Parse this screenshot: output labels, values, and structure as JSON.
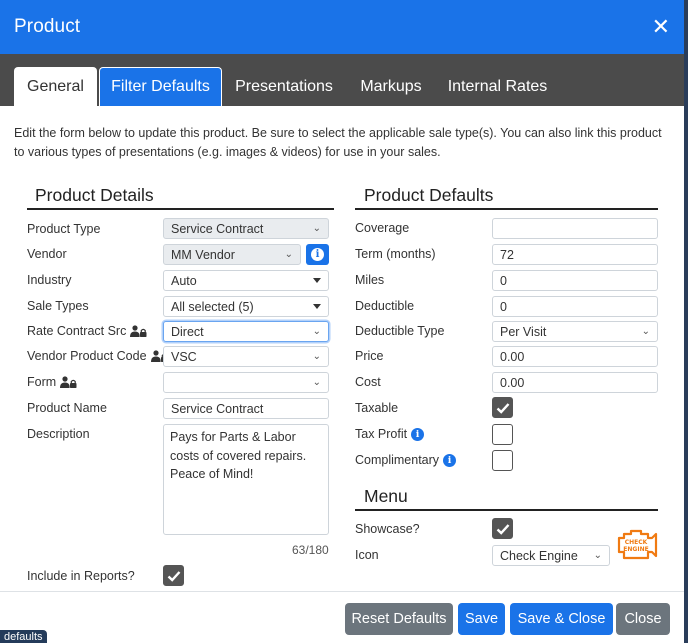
{
  "modal": {
    "title": "Product"
  },
  "tabs": [
    "General",
    "Filter Defaults",
    "Presentations",
    "Markups",
    "Internal Rates"
  ],
  "intro": "Edit the form below to update this product. Be sure to select the applicable sale type(s). You can also link this product to various types of presentations (e.g. images & videos) for use in your sales.",
  "product_details": {
    "title": "Product Details",
    "product_type": {
      "label": "Product Type",
      "value": "Service Contract"
    },
    "vendor": {
      "label": "Vendor",
      "value": "MM Vendor"
    },
    "industry": {
      "label": "Industry",
      "value": "Auto"
    },
    "sale_types": {
      "label": "Sale Types",
      "value": "All selected (5)"
    },
    "rate_contract_src": {
      "label": "Rate Contract Src",
      "value": "Direct"
    },
    "vendor_product_code": {
      "label": "Vendor Product Code",
      "value": "VSC"
    },
    "form": {
      "label": "Form",
      "value": ""
    },
    "product_name": {
      "label": "Product Name",
      "value": "Service Contract"
    },
    "description": {
      "label": "Description",
      "value": "Pays for Parts & Labor costs of covered repairs. Peace of Mind!",
      "counter": "63/180"
    },
    "include_in_reports": {
      "label": "Include in Reports?",
      "checked": true
    }
  },
  "product_defaults": {
    "title": "Product Defaults",
    "coverage": {
      "label": "Coverage",
      "value": ""
    },
    "term": {
      "label": "Term (months)",
      "value": "72"
    },
    "miles": {
      "label": "Miles",
      "value": "0"
    },
    "deductible": {
      "label": "Deductible",
      "value": "0"
    },
    "deductible_type": {
      "label": "Deductible Type",
      "value": "Per Visit"
    },
    "price": {
      "label": "Price",
      "value": "0.00"
    },
    "cost": {
      "label": "Cost",
      "value": "0.00"
    },
    "taxable": {
      "label": "Taxable",
      "checked": true
    },
    "tax_profit": {
      "label": "Tax Profit",
      "checked": false
    },
    "complimentary": {
      "label": "Complimentary",
      "checked": false
    }
  },
  "menu": {
    "title": "Menu",
    "showcase": {
      "label": "Showcase?",
      "checked": true
    },
    "icon": {
      "label": "Icon",
      "value": "Check Engine",
      "badge_line1": "CHECK",
      "badge_line2": "ENGINE"
    }
  },
  "footer": {
    "reset": "Reset Defaults",
    "save": "Save",
    "save_close": "Save & Close",
    "close": "Close"
  },
  "background": {
    "tag": "defaults"
  },
  "colors": {
    "primary": "#1a73e8",
    "secondary": "#6c757d",
    "tabbar": "#4b4b4b",
    "icon_orange": "#f07a12"
  }
}
